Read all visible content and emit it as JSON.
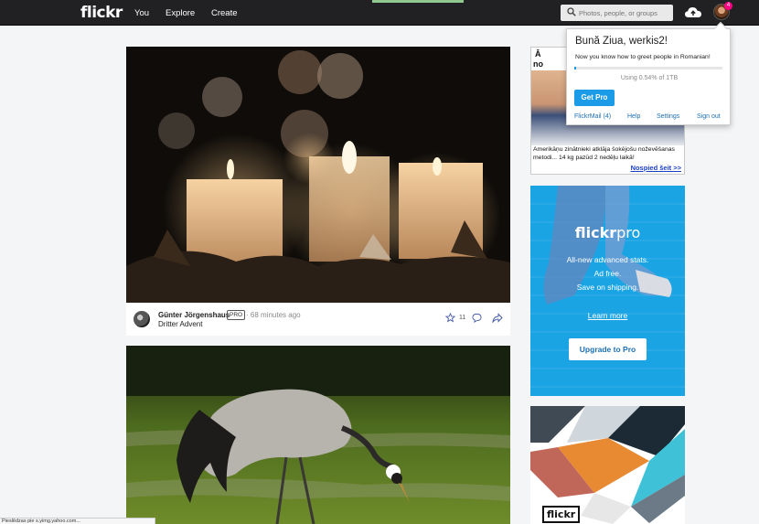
{
  "nav": {
    "logo": "flickr",
    "links": [
      "You",
      "Explore",
      "Create"
    ],
    "search_placeholder": "Photos, people, or groups",
    "notification_count": "4"
  },
  "feed": {
    "post1": {
      "author": "Günter Jörgenshaus",
      "badge": "PRO",
      "time": "· 68 minutes ago",
      "title": "Dritter Advent",
      "fav_count": "11"
    }
  },
  "ad1": {
    "heading_line1": "Ā",
    "heading_line2": "no",
    "text": "Amerikāņu zinātnieki atklāja šokējošu noževēšanas metodi... 14 kg pazūd 2 nedēļu laikā!",
    "more_link": "Nospied šeit >>"
  },
  "ad2": {
    "brand_bold": "flickr",
    "brand_light": "pro",
    "line1": "All-new advanced stats.",
    "line2": "Ad free.",
    "line3": "Save on shipping.",
    "learn_more": "Learn more",
    "upgrade_button": "Upgrade to Pro"
  },
  "ad3": {
    "badge": "flickr"
  },
  "popup": {
    "greeting": "Bună Ziua, werkis2!",
    "fact": "Now you know how to greet people in Romanian!",
    "usage_text": "Using 0.54% of 1TB",
    "usage_percent": 0.54,
    "get_pro": "Get Pro",
    "links": [
      "FlickrMail (4)",
      "Help",
      "Settings",
      "Sign out"
    ]
  },
  "statusbar": {
    "text": "Pieslēdzas pie s.yimg.yahoo.com..."
  },
  "colors": {
    "nav_bg": "#212124",
    "accent_blue": "#1c9be6",
    "pro_blue": "#1aa4e4",
    "notif_pink": "#ff0084"
  }
}
